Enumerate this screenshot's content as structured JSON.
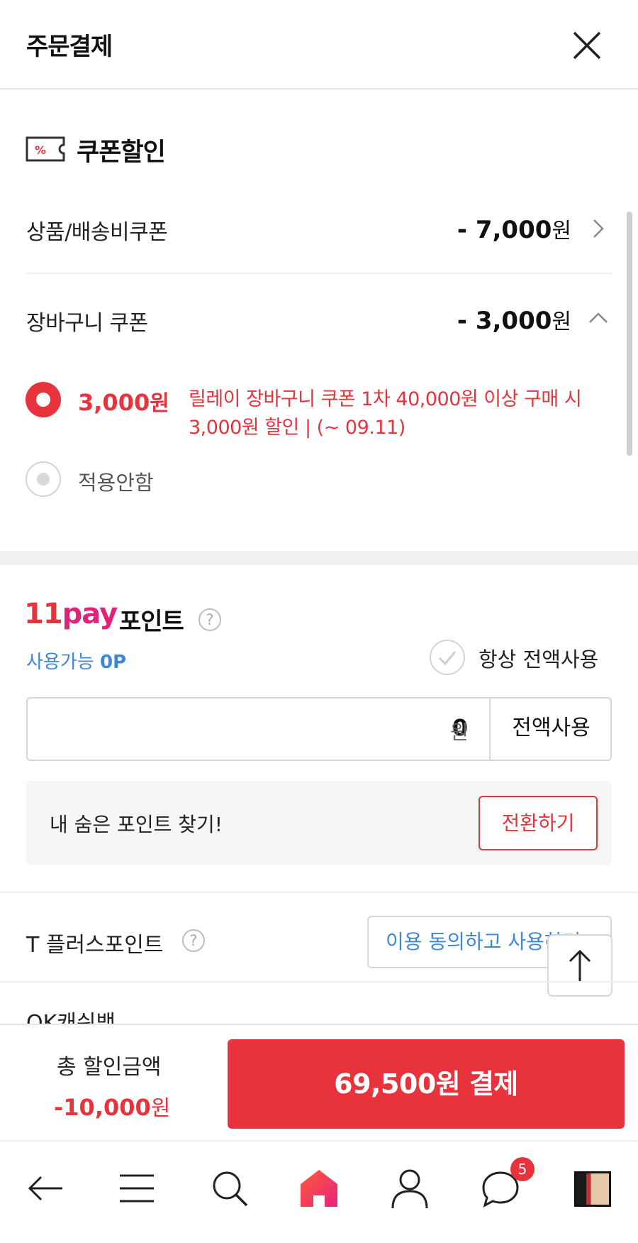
{
  "header": {
    "title": "주문결제"
  },
  "coupon": {
    "title": "쿠폰할인",
    "icon_text": "%",
    "product_shipping": {
      "label": "상품/배송비쿠폰",
      "amount": "- 7,000",
      "unit": "원"
    },
    "cart": {
      "label": "장바구니 쿠폰",
      "amount": "- 3,000",
      "unit": "원"
    },
    "selected_option": {
      "price": "3,000",
      "unit": "원",
      "description": "릴레이 장바구니 쿠폰 1차 40,000원 이상 구매 시 3,000원 할인 | (~ 09.11)"
    },
    "none_option": {
      "label": "적용안함"
    }
  },
  "pay_point": {
    "logo_11": "11",
    "logo_pay": "pay",
    "title": "포인트",
    "help": "?",
    "available_label": "사용가능",
    "available_value": "0P",
    "always_all_label": "항상 전액사용",
    "input_value": "0",
    "input_unit": "원",
    "use_all_button": "전액사용",
    "hidden_point_label": "내 숨은 포인트 찾기!",
    "convert_button": "전환하기"
  },
  "tplus": {
    "label": "T 플러스포인트",
    "help": "?",
    "button": "이용 동의하고 사용하기"
  },
  "ok_cashbag": {
    "label": "OK캐쉬백"
  },
  "summary": {
    "total_label": "총 할인금액",
    "total_value": "-10,000",
    "total_unit": "원",
    "pay_button": "69,500원 결제"
  },
  "bottom_nav": {
    "chat_badge": "5"
  },
  "colors": {
    "accent": "#e8323c",
    "link": "#3d87d8",
    "pay_pink": "#e0227a"
  }
}
